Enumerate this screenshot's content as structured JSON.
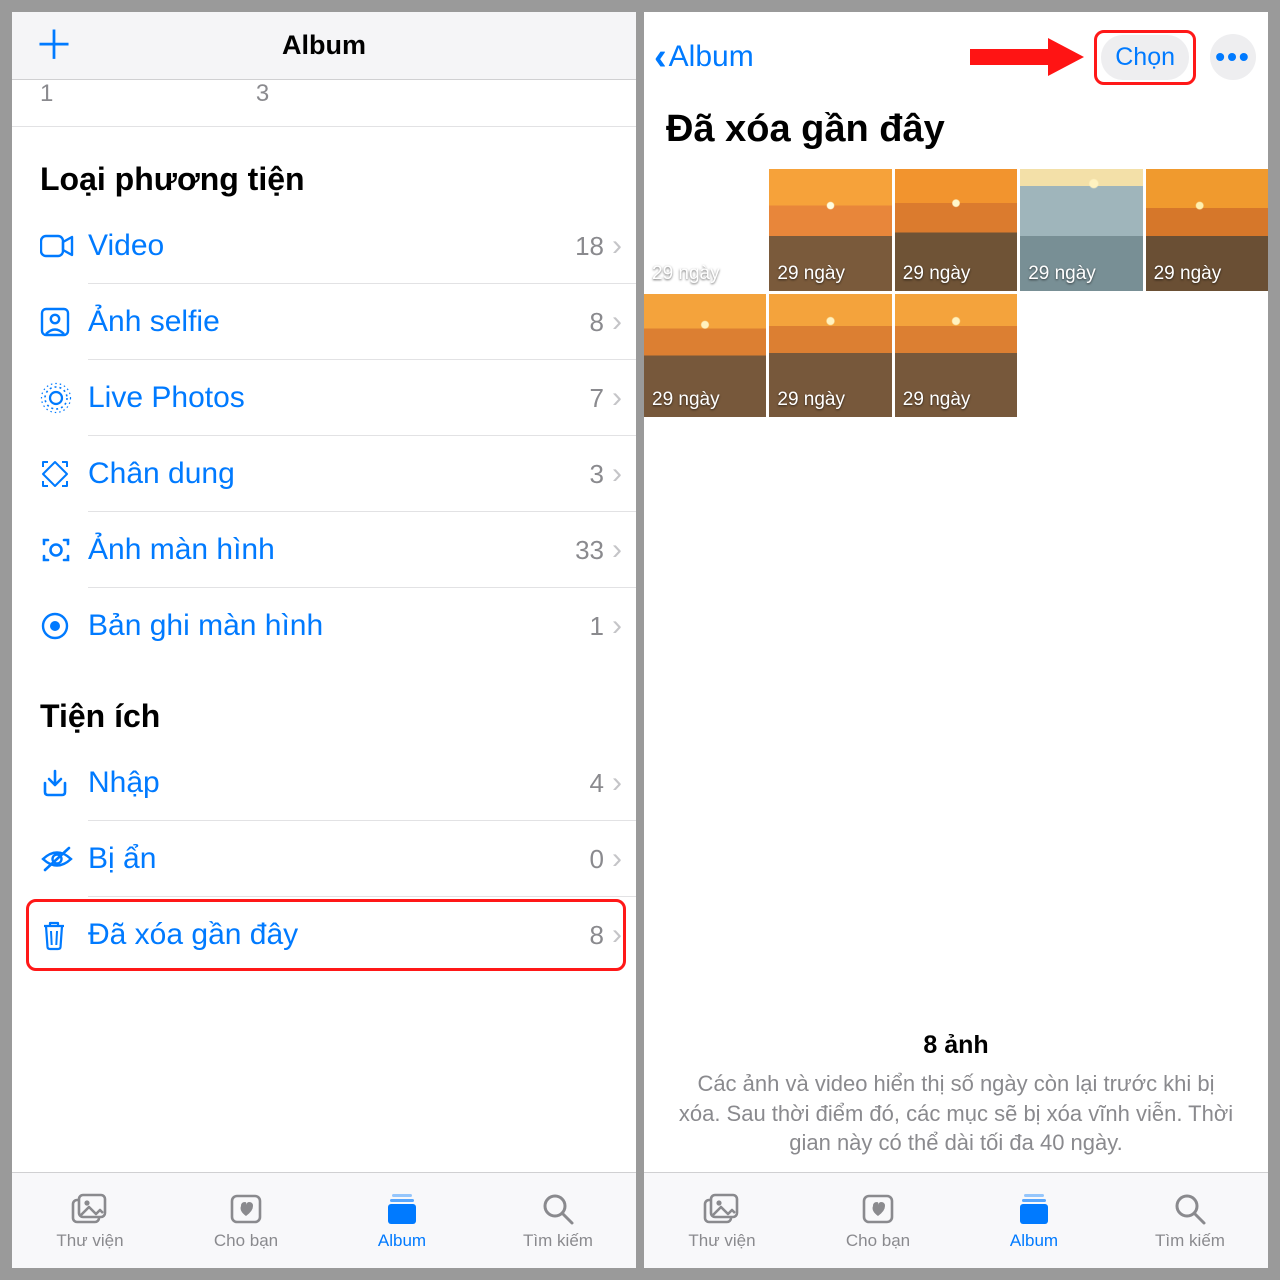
{
  "left": {
    "nav_title": "Album",
    "stubs": [
      "1",
      "3"
    ],
    "section_media": "Loại phương tiện",
    "section_util": "Tiện ích",
    "media_rows": [
      {
        "icon": "video-icon",
        "label": "Video",
        "count": "18"
      },
      {
        "icon": "selfie-icon",
        "label": "Ảnh selfie",
        "count": "8"
      },
      {
        "icon": "livephotos-icon",
        "label": "Live Photos",
        "count": "7"
      },
      {
        "icon": "portrait-icon",
        "label": "Chân dung",
        "count": "3"
      },
      {
        "icon": "screenshot-icon",
        "label": "Ảnh màn hình",
        "count": "33"
      },
      {
        "icon": "screenrec-icon",
        "label": "Bản ghi màn hình",
        "count": "1"
      }
    ],
    "util_rows": [
      {
        "icon": "import-icon",
        "label": "Nhập",
        "count": "4"
      },
      {
        "icon": "hidden-icon",
        "label": "Bị ẩn",
        "count": "0"
      },
      {
        "icon": "trash-icon",
        "label": "Đã xóa gần đây",
        "count": "8"
      }
    ]
  },
  "right": {
    "back_label": "Album",
    "select_label": "Chọn",
    "page_title": "Đã xóa gần đây",
    "thumbs": [
      {
        "bg": "bg-night",
        "label": "29 ngày"
      },
      {
        "bg": "bg-sunset1",
        "label": "29 ngày"
      },
      {
        "bg": "bg-sunset2",
        "label": "29 ngày"
      },
      {
        "bg": "bg-sea",
        "label": "29 ngày"
      },
      {
        "bg": "bg-sunset3",
        "label": "29 ngày"
      },
      {
        "bg": "bg-sunset4",
        "label": "29 ngày"
      },
      {
        "bg": "bg-sunset5",
        "label": "29 ngày"
      },
      {
        "bg": "bg-sunset6",
        "label": "29 ngày"
      }
    ],
    "footer_title": "8 ảnh",
    "footer_body": "Các ảnh và video hiển thị số ngày còn lại trước khi bị xóa. Sau thời điểm đó, các mục sẽ bị xóa vĩnh viễn. Thời gian này có thể dài tối đa 40 ngày."
  },
  "tabs": [
    {
      "label": "Thư viện",
      "active": false
    },
    {
      "label": "Cho bạn",
      "active": false
    },
    {
      "label": "Album",
      "active": true
    },
    {
      "label": "Tìm kiếm",
      "active": false
    }
  ]
}
